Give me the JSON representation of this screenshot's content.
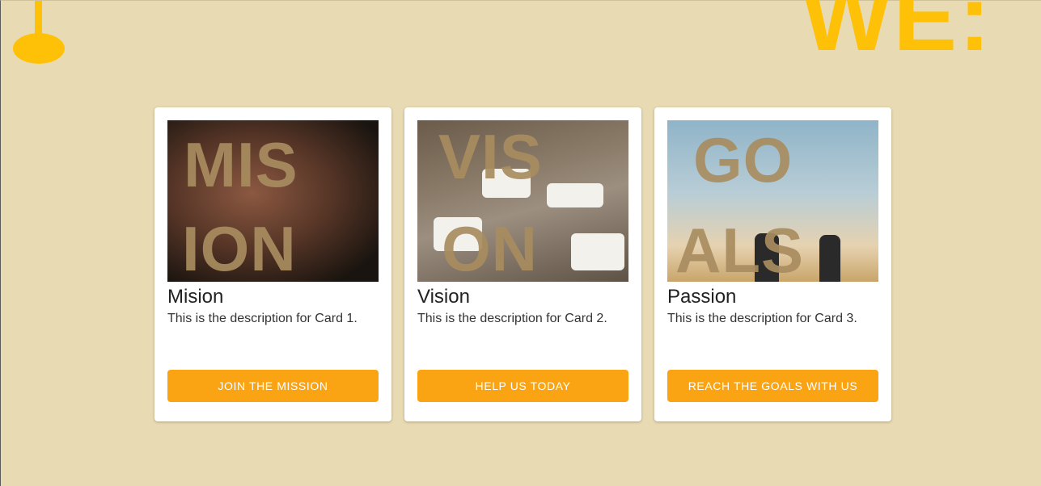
{
  "decor": {
    "header_text": "WE:"
  },
  "cards": [
    {
      "image_text_top": "MIS",
      "image_text_bottom": "ION",
      "title": "Mision",
      "description": "This is the description for Card 1.",
      "button_label": "JOIN THE MISSION"
    },
    {
      "image_text_top": "VIS",
      "image_text_bottom": "ON",
      "title": "Vision",
      "description": "This is the description for Card 2.",
      "button_label": "HELP US TODAY"
    },
    {
      "image_text_top": "GO",
      "image_text_bottom": "ALS",
      "title": "Passion",
      "description": "This is the description for Card 3.",
      "button_label": "REACH THE GOALS WITH US"
    }
  ],
  "colors": {
    "background": "#e8dab3",
    "accent_yellow": "#ffc107",
    "button": "#fba413",
    "card": "#ffffff"
  }
}
